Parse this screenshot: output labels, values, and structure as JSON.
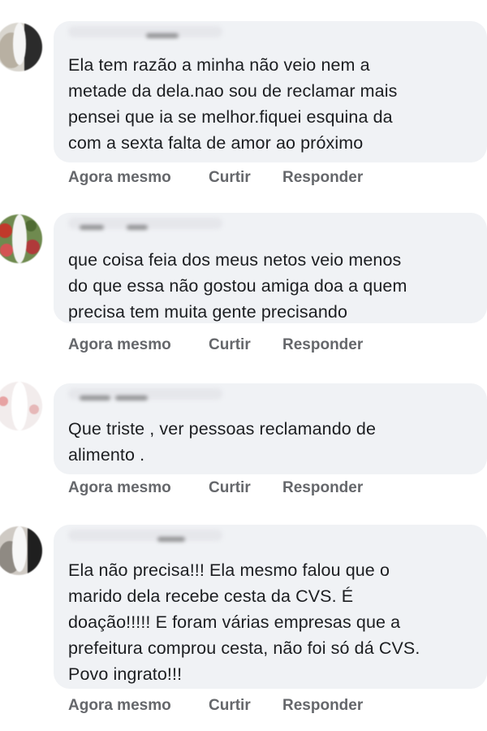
{
  "comments": [
    {
      "lines": [
        "Ela tem razão a minha não veio nem a",
        "metade da dela.nao sou de reclamar mais",
        "pensei que ia se melhor.fiquei esquina da",
        "com a sexta falta de amor ao próximo"
      ],
      "time": "Agora mesmo",
      "like": "Curtir",
      "reply": "Responder"
    },
    {
      "lines": [
        "que coisa feia dos meus netos veio menos",
        "do que essa não gostou amiga doa a quem",
        "precisa tem muita gente precisando"
      ],
      "time": "Agora mesmo",
      "like": "Curtir",
      "reply": "Responder"
    },
    {
      "lines": [
        "Que triste , ver pessoas reclamando de",
        "alimento ."
      ],
      "time": "Agora mesmo",
      "like": "Curtir",
      "reply": "Responder"
    },
    {
      "lines": [
        "Ela não precisa!!! Ela mesmo falou que o",
        "marido dela recebe cesta da CVS. É",
        "doação!!!!! E foram várias empresas que a",
        "prefeitura comprou cesta, não foi só dá CVS.",
        "Povo ingrato!!!"
      ],
      "time": "Agora mesmo",
      "like": "Curtir",
      "reply": "Responder"
    }
  ],
  "colors": {
    "bubble": "#f0f2f5",
    "text": "#1c1e21",
    "action": "#65676b"
  }
}
